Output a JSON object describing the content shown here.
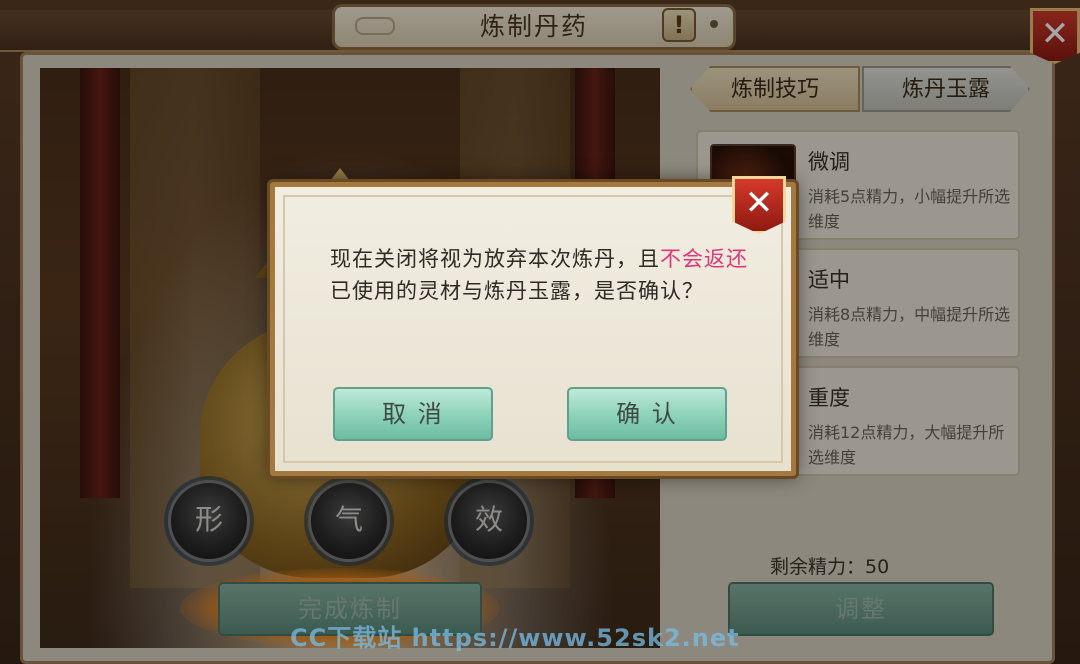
{
  "window": {
    "title": "炼制丹药",
    "help_label": "!",
    "close_label": "✕"
  },
  "scene": {
    "attributes": [
      "形",
      "气",
      "效"
    ],
    "complete_button": "完成炼制"
  },
  "tabs": [
    {
      "label": "炼制技巧",
      "active": true
    },
    {
      "label": "炼丹玉露",
      "active": false
    }
  ],
  "techniques": [
    {
      "title": "微调",
      "desc": "消耗5点精力，小幅提升所选维度"
    },
    {
      "title": "适中",
      "desc": "消耗8点精力，中幅提升所选维度"
    },
    {
      "title": "重度",
      "desc": "消耗12点精力，大幅提升所选维度"
    }
  ],
  "energy": {
    "label": "剩余精力：50"
  },
  "adjust_button": "调整",
  "modal": {
    "text_before": "现在关闭将视为放弃本次炼丹，且",
    "text_highlight": "不会返还",
    "text_after": "已使用的灵材与炼丹玉露，是否确认？",
    "cancel_label": "取 消",
    "confirm_label": "确 认",
    "close_label": "✕",
    "highlight_color": "#e0377a"
  },
  "watermark": "CC下载站 https://www.52sk2.net"
}
